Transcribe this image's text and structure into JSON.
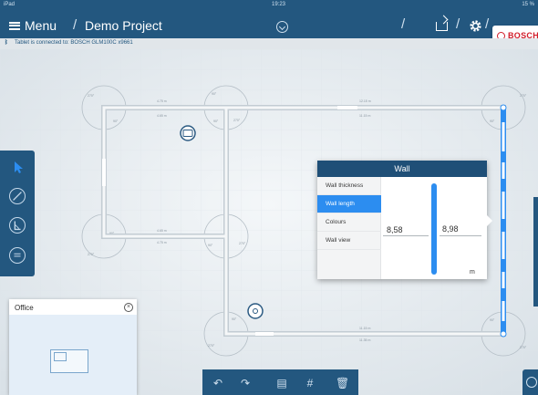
{
  "status_bar": {
    "left": "iPad",
    "time": "19:23",
    "right": "15 %"
  },
  "header": {
    "menu_label": "Menu",
    "separator": "/",
    "project": "Demo Project"
  },
  "brand": {
    "logo_text": "BOSCH"
  },
  "connection": {
    "text": "Tablet is connected to: BOSCH GLM100C x9661"
  },
  "wall_dialog": {
    "title": "Wall",
    "menu": [
      "Wall thickness",
      "Wall length",
      "Colours",
      "Wall view"
    ],
    "active_index": 1,
    "value_old": "8,58",
    "value_new": "8,98",
    "unit": "m"
  },
  "office_panel": {
    "title": "Office",
    "close_symbol": "×"
  },
  "bottom_toolbar": {
    "undo": "↶",
    "redo": "↷",
    "calc": "▤",
    "grid": "#",
    "trash": "🗑"
  },
  "left_toolbar": [
    "select-icon",
    "draw-icon",
    "measure-icon",
    "annotate-icon"
  ],
  "colors": {
    "primary": "#23577f",
    "accent": "#2c8df0",
    "brand_red": "#d11d2a"
  }
}
